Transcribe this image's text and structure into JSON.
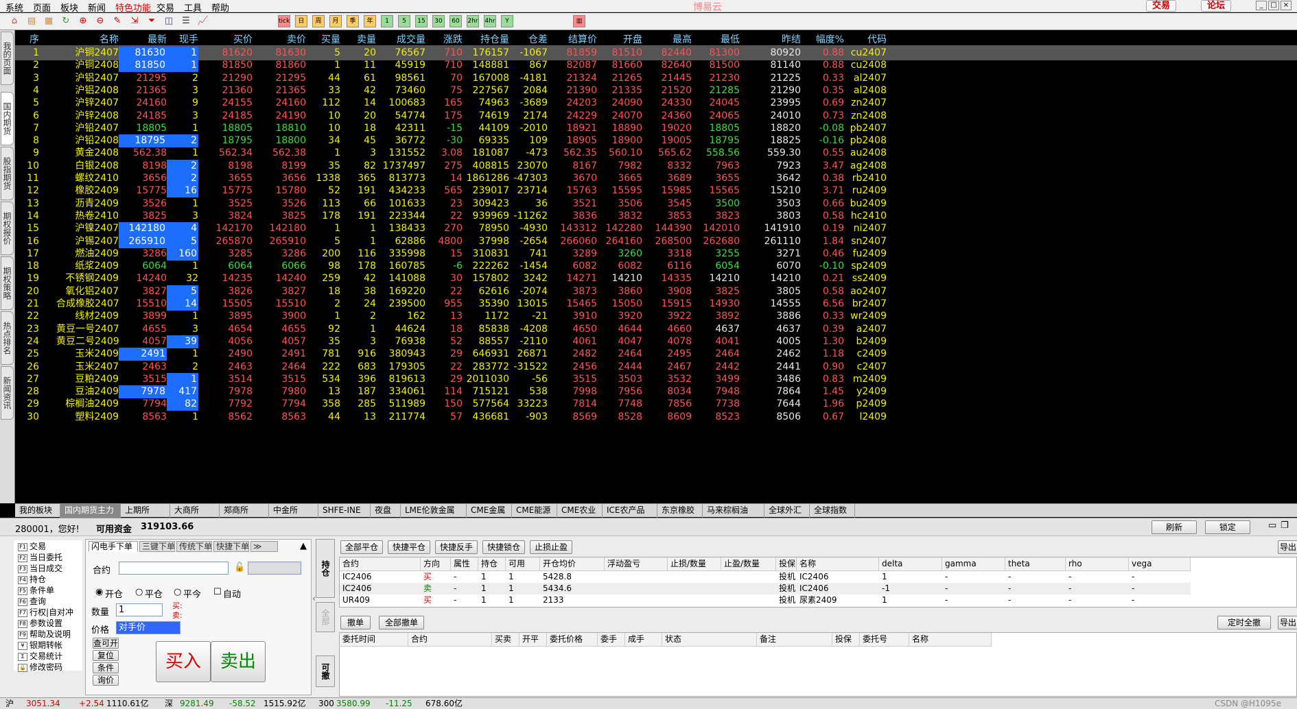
{
  "menubar": {
    "items": [
      "系统",
      "页面",
      "板块",
      "新闻",
      "特色功能",
      "交易",
      "工具",
      "帮助"
    ],
    "title": "博易云",
    "trade_btn": "交易",
    "forum_btn": "论坛"
  },
  "toolbar": {
    "icons": [
      "home-icon",
      "book-icon",
      "layers-icon",
      "refresh-icon",
      "zoom-in-icon",
      "zoom-out-icon",
      "pen-icon",
      "select-icon",
      "funnel-icon",
      "stock-icon",
      "list-view-icon",
      "line-chart-icon"
    ],
    "periods": [
      "tick",
      "日",
      "周",
      "月",
      "季",
      "年",
      "1",
      "5",
      "15",
      "30",
      "60",
      "2hr",
      "4hr",
      "Y"
    ]
  },
  "left_tabs": [
    "我的页面",
    "国内期货",
    "股指期货",
    "期权报价",
    "期权策略",
    "热点排名",
    "新闻资讯"
  ],
  "quote": {
    "headers": [
      "序",
      "名称",
      "最新",
      "现手",
      "买价",
      "卖价",
      "买量",
      "卖量",
      "成交量",
      "涨跌",
      "持仓量",
      "仓差",
      "结算价",
      "开盘",
      "最高",
      "最低",
      "昨结",
      "幅度%",
      "代码"
    ],
    "rows": [
      [
        "1",
        "沪铜2407",
        "81630",
        "1",
        "81620",
        "81630",
        "5",
        "20",
        "76567",
        "710",
        "176157",
        "-1067",
        "81859",
        "81510",
        "82440",
        "81300",
        "80920",
        "0.88",
        "cu2407"
      ],
      [
        "2",
        "沪铜2408",
        "81850",
        "1",
        "81850",
        "81860",
        "1",
        "11",
        "45919",
        "710",
        "148881",
        "867",
        "82087",
        "81660",
        "82640",
        "81500",
        "81140",
        "0.88",
        "cu2408"
      ],
      [
        "3",
        "沪铝2407",
        "21295",
        "2",
        "21290",
        "21295",
        "44",
        "61",
        "98561",
        "70",
        "167008",
        "-4181",
        "21324",
        "21265",
        "21445",
        "21230",
        "21225",
        "0.33",
        "al2407"
      ],
      [
        "4",
        "沪铝2408",
        "21365",
        "3",
        "21360",
        "21365",
        "33",
        "42",
        "73460",
        "75",
        "227567",
        "2084",
        "21390",
        "21335",
        "21520",
        "21285",
        "21290",
        "0.35",
        "al2408"
      ],
      [
        "5",
        "沪锌2407",
        "24160",
        "9",
        "24155",
        "24160",
        "112",
        "14",
        "100683",
        "165",
        "74963",
        "-3689",
        "24203",
        "24090",
        "24330",
        "24045",
        "23995",
        "0.69",
        "zn2407"
      ],
      [
        "6",
        "沪锌2408",
        "24185",
        "3",
        "24185",
        "24190",
        "10",
        "20",
        "54774",
        "175",
        "74619",
        "2174",
        "24229",
        "24070",
        "24360",
        "24065",
        "24010",
        "0.73",
        "zn2408"
      ],
      [
        "7",
        "沪铅2407",
        "18805",
        "1",
        "18805",
        "18810",
        "10",
        "18",
        "42311",
        "-15",
        "44109",
        "-2010",
        "18921",
        "18890",
        "19020",
        "18805",
        "18820",
        "-0.08",
        "pb2407"
      ],
      [
        "8",
        "沪铅2408",
        "18795",
        "2",
        "18795",
        "18800",
        "34",
        "45",
        "36772",
        "-30",
        "69335",
        "109",
        "18905",
        "18900",
        "19005",
        "18795",
        "18825",
        "-0.16",
        "pb2408"
      ],
      [
        "9",
        "黄金2408",
        "562.38",
        "1",
        "562.34",
        "562.38",
        "1",
        "3",
        "131552",
        "3.08",
        "181087",
        "-473",
        "562.35",
        "560.10",
        "565.62",
        "558.56",
        "559.30",
        "0.55",
        "au2408"
      ],
      [
        "10",
        "白银2408",
        "8198",
        "2",
        "8198",
        "8199",
        "35",
        "82",
        "1737497",
        "275",
        "408815",
        "23070",
        "8167",
        "7982",
        "8332",
        "7963",
        "7923",
        "3.47",
        "ag2408"
      ],
      [
        "11",
        "螺纹2410",
        "3656",
        "2",
        "3655",
        "3656",
        "1338",
        "365",
        "813773",
        "14",
        "1861286",
        "-47303",
        "3670",
        "3665",
        "3689",
        "3655",
        "3642",
        "0.38",
        "rb2410"
      ],
      [
        "12",
        "橡胶2409",
        "15775",
        "16",
        "15775",
        "15780",
        "52",
        "191",
        "434233",
        "565",
        "239017",
        "23714",
        "15763",
        "15595",
        "15985",
        "15565",
        "15210",
        "3.71",
        "ru2409"
      ],
      [
        "13",
        "沥青2409",
        "3526",
        "1",
        "3525",
        "3526",
        "113",
        "66",
        "101633",
        "23",
        "309423",
        "36",
        "3521",
        "3506",
        "3545",
        "3500",
        "3503",
        "0.66",
        "bu2409"
      ],
      [
        "14",
        "热卷2410",
        "3825",
        "3",
        "3824",
        "3825",
        "178",
        "191",
        "223344",
        "22",
        "939969",
        "-11262",
        "3836",
        "3832",
        "3853",
        "3823",
        "3803",
        "0.58",
        "hc2410"
      ],
      [
        "15",
        "沪镍2407",
        "142180",
        "4",
        "142170",
        "142180",
        "1",
        "1",
        "138433",
        "270",
        "78950",
        "-4930",
        "143312",
        "142280",
        "144390",
        "142010",
        "141910",
        "0.19",
        "ni2407"
      ],
      [
        "16",
        "沪锡2407",
        "265910",
        "5",
        "265870",
        "265910",
        "5",
        "1",
        "62886",
        "4800",
        "37998",
        "-2654",
        "266060",
        "264160",
        "268500",
        "262680",
        "261110",
        "1.84",
        "sn2407"
      ],
      [
        "17",
        "燃油2409",
        "3286",
        "160",
        "3285",
        "3286",
        "200",
        "116",
        "335998",
        "15",
        "310831",
        "741",
        "3289",
        "3260",
        "3318",
        "3255",
        "3271",
        "0.46",
        "fu2409"
      ],
      [
        "18",
        "纸浆2409",
        "6064",
        "1",
        "6064",
        "6066",
        "98",
        "178",
        "160785",
        "-6",
        "222262",
        "-1454",
        "6082",
        "6082",
        "6116",
        "6054",
        "6070",
        "-0.10",
        "sp2409"
      ],
      [
        "19",
        "不锈钢2409",
        "14240",
        "32",
        "14235",
        "14240",
        "259",
        "42",
        "141088",
        "30",
        "157802",
        "3242",
        "14271",
        "14210",
        "14335",
        "14210",
        "14210",
        "0.21",
        "ss2409"
      ],
      [
        "20",
        "氧化铝2407",
        "3827",
        "5",
        "3826",
        "3827",
        "18",
        "38",
        "169220",
        "22",
        "62616",
        "-2074",
        "3873",
        "3860",
        "3908",
        "3825",
        "3805",
        "0.58",
        "ao2407"
      ],
      [
        "21",
        "合成橡胶2407",
        "15510",
        "14",
        "15505",
        "15510",
        "2",
        "24",
        "239500",
        "955",
        "35390",
        "13015",
        "15465",
        "15050",
        "15915",
        "14930",
        "14555",
        "6.56",
        "br2407"
      ],
      [
        "22",
        "线材2409",
        "3899",
        "1",
        "3895",
        "3900",
        "1",
        "2",
        "162",
        "13",
        "1172",
        "-21",
        "3910",
        "3920",
        "3922",
        "3892",
        "3886",
        "0.33",
        "wr2409"
      ],
      [
        "23",
        "黄豆一号2407",
        "4655",
        "3",
        "4654",
        "4655",
        "92",
        "1",
        "44624",
        "18",
        "85838",
        "-4208",
        "4650",
        "4644",
        "4660",
        "4637",
        "4637",
        "0.39",
        "a2407"
      ],
      [
        "24",
        "黄豆二号2409",
        "4057",
        "39",
        "4056",
        "4057",
        "35",
        "3",
        "76938",
        "52",
        "88557",
        "-2110",
        "4061",
        "4047",
        "4078",
        "4041",
        "4005",
        "1.30",
        "b2409"
      ],
      [
        "25",
        "玉米2409",
        "2491",
        "1",
        "2490",
        "2491",
        "781",
        "916",
        "380943",
        "29",
        "646931",
        "26871",
        "2482",
        "2464",
        "2495",
        "2464",
        "2462",
        "1.18",
        "c2409"
      ],
      [
        "26",
        "玉米2407",
        "2463",
        "2",
        "2463",
        "2464",
        "222",
        "683",
        "179305",
        "22",
        "283772",
        "-31522",
        "2456",
        "2444",
        "2467",
        "2442",
        "2441",
        "0.90",
        "c2407"
      ],
      [
        "27",
        "豆粕2409",
        "3515",
        "1",
        "3514",
        "3515",
        "534",
        "396",
        "819613",
        "29",
        "2011030",
        "-56",
        "3515",
        "3503",
        "3532",
        "3499",
        "3486",
        "0.83",
        "m2409"
      ],
      [
        "28",
        "豆油2409",
        "7978",
        "417",
        "7978",
        "7980",
        "13",
        "187",
        "334061",
        "114",
        "715121",
        "538",
        "7998",
        "7956",
        "8034",
        "7948",
        "7864",
        "1.45",
        "y2409"
      ],
      [
        "29",
        "棕榈油2409",
        "7794",
        "82",
        "7792",
        "7794",
        "358",
        "285",
        "511989",
        "150",
        "577564",
        "33223",
        "7814",
        "7748",
        "7856",
        "7738",
        "7644",
        "1.96",
        "p2409"
      ],
      [
        "30",
        "塑料2409",
        "8563",
        "1",
        "8562",
        "8563",
        "44",
        "13",
        "211774",
        "57",
        "436681",
        "-903",
        "8569",
        "8528",
        "8609",
        "8523",
        "8506",
        "0.67",
        "l2409"
      ]
    ]
  },
  "exchange_tabs": [
    "我的板块",
    "国内期货主力",
    "上期所",
    "大商所",
    "郑商所",
    "中金所",
    "SHFE-INE",
    "夜盘",
    "LME伦敦金属",
    "CME金属",
    "CME能源",
    "CME农业",
    "ICE农产品",
    "东京橡胶",
    "马来棕榈油",
    "全球外汇",
    "全球指数"
  ],
  "trade": {
    "account": "280001，您好!",
    "funds_label": "可用资金",
    "funds_value": "319103.66",
    "refresh": "刷新",
    "lock": "锁定",
    "export": "导出",
    "nav": [
      "交易",
      "当日委托",
      "当日成交",
      "持仓",
      "条件单",
      "查询",
      "行权|自对冲",
      "参数设置",
      "帮助及说明",
      "银期转帐",
      "交易统计",
      "修改密码"
    ],
    "nav_keys": [
      "F1",
      "F2",
      "F3",
      "F4",
      "F5",
      "F6",
      "F7",
      "F8",
      "F9",
      "¥",
      "Σ",
      "🔒"
    ],
    "order_tabs": [
      "闪电手下单",
      "三键下单",
      "传统下单",
      "快捷下单"
    ],
    "contract_label": "合约",
    "open": "开仓",
    "close": "平仓",
    "close_today": "平今",
    "auto": "自动",
    "qty_label": "数量",
    "qty": "1",
    "buy_hint": "买:",
    "sell_hint": "卖:",
    "price_label": "价格",
    "price": "对手价",
    "btn_qk": "查可开",
    "btn_reset": "复位",
    "btn_cond": "条件",
    "btn_quote": "询价",
    "buy": "买入",
    "sell": "卖出",
    "side_pos": "持仓",
    "side_all": "全部",
    "side_cancel": "可撤",
    "pos_btns": [
      "全部平仓",
      "快捷平仓",
      "快捷反手",
      "快捷锁仓",
      "止损止盈"
    ],
    "pos_headers": [
      "合约",
      "方向",
      "属性",
      "持仓",
      "可用",
      "开仓均价",
      "浮动盈亏",
      "止损/数量",
      "止盈/数量",
      "投保",
      "名称",
      "delta",
      "gamma",
      "theta",
      "rho",
      "vega"
    ],
    "pos_rows": [
      [
        "IC2406",
        "买",
        "-",
        "1",
        "1",
        "5428.8",
        "",
        "",
        "",
        "投机",
        "IC2406",
        "1",
        "-",
        "-",
        "-",
        "-"
      ],
      [
        "IC2406",
        "卖",
        "-",
        "1",
        "1",
        "5434.6",
        "",
        "",
        "",
        "投机",
        "IC2406",
        "-1",
        "-",
        "-",
        "-",
        "-"
      ],
      [
        "UR409",
        "买",
        "-",
        "1",
        "1",
        "2133",
        "",
        "",
        "",
        "投机",
        "尿素2409",
        "1",
        "-",
        "-",
        "-",
        "-"
      ]
    ],
    "ord_btns": [
      "撤单",
      "全部撤单",
      "定时全撤"
    ],
    "ord_headers": [
      "委托时间",
      "合约",
      "买卖",
      "开平",
      "委托价格",
      "委手",
      "成手",
      "状态",
      "备注",
      "投保",
      "委托号",
      "名称"
    ]
  },
  "status": {
    "sh": "沪",
    "sh_v": "3051.34",
    "sh_c": "+2.54",
    "sh_a": "1110.61亿",
    "sz": "深",
    "sz_v": "9281.49",
    "sz_c": "-58.52",
    "sz_a": "1515.92亿",
    "hs": "300",
    "hs_v": "3580.99",
    "hs_c": "-11.25",
    "hs_a": "678.60亿",
    "brand": "CSDN @H1095e"
  }
}
